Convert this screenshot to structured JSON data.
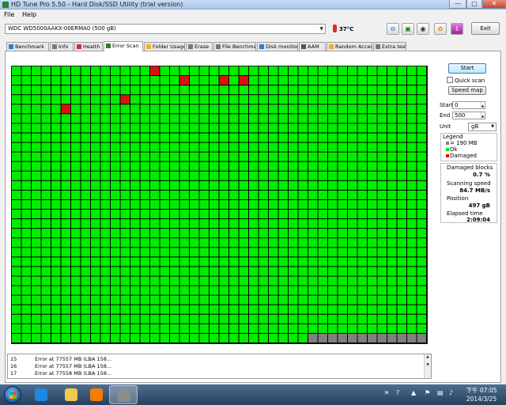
{
  "window": {
    "title": "HD Tune Pro 5.50 - Hard Disk/SSD Utility (trial version)"
  },
  "title_buttons": {
    "minimize": "—",
    "maximize": "□",
    "close": "✕"
  },
  "menu": [
    "File",
    "Help"
  ],
  "toolbar": {
    "drive": "WDC WD5000AAKX-00ERMA0 (500 gB)",
    "temperature": "37°C",
    "exit_label": "Exit",
    "icon_buttons": [
      "copy-icon",
      "save-icon",
      "camera-icon",
      "settings-icon",
      "download-icon"
    ]
  },
  "tabs": [
    {
      "label": "Benchmark",
      "icon": "benchmark-icon",
      "color": "#2b7bd6"
    },
    {
      "label": "Info",
      "icon": "info-icon",
      "color": "#777777"
    },
    {
      "label": "Health",
      "icon": "health-icon",
      "color": "#d32f2f"
    },
    {
      "label": "Error Scan",
      "icon": "magnifier-icon",
      "color": "#2e7d32",
      "active": true
    },
    {
      "label": "Folder Usage",
      "icon": "folder-icon",
      "color": "#f2b320"
    },
    {
      "label": "Erase",
      "icon": "erase-icon",
      "color": "#777777"
    },
    {
      "label": "File Benchmark",
      "icon": "file-icon",
      "color": "#777777"
    },
    {
      "label": "Disk monitor",
      "icon": "monitor-icon",
      "color": "#2b7bd6"
    },
    {
      "label": "AAM",
      "icon": "speaker-icon",
      "color": "#555555"
    },
    {
      "label": "Random Access",
      "icon": "random-icon",
      "color": "#f2b320"
    },
    {
      "label": "Extra tests",
      "icon": "tests-icon",
      "color": "#777777"
    }
  ],
  "scan_map": {
    "cols": 42,
    "rows": 29,
    "colors": {
      "ok": "#00ee00",
      "damaged": "#dd1111",
      "unscanned": "#808080",
      "border": "#000000"
    },
    "damaged_blocks": [
      [
        0,
        14
      ],
      [
        1,
        17
      ],
      [
        1,
        21
      ],
      [
        1,
        23
      ],
      [
        3,
        11
      ],
      [
        4,
        5
      ]
    ],
    "unscanned_start_in_last_row": 30
  },
  "controls": {
    "start_button": "Start",
    "quick_scan_label": "Quick scan",
    "quick_scan_checked": false,
    "speed_map_button": "Speed map",
    "start_label": "Start",
    "start_value": "0",
    "end_label": "End",
    "end_value": "500",
    "unit_label": "Unit",
    "unit_value": "gB"
  },
  "legend": {
    "title": "Legend",
    "items": [
      {
        "swatch": "#808080",
        "label": "= 190 MB"
      },
      {
        "swatch": "#00ee00",
        "label": "Ok"
      },
      {
        "swatch": "#dd1111",
        "label": "Damaged"
      }
    ]
  },
  "stats": {
    "damaged_blocks_label": "Damaged blocks",
    "damaged_blocks_value": "0.7 %",
    "scanning_speed_label": "Scanning speed",
    "scanning_speed_value": "84.7 MB/s",
    "position_label": "Position",
    "position_value": "497 gB",
    "elapsed_time_label": "Elapsed time",
    "elapsed_time_value": "2:09:04"
  },
  "log": [
    {
      "num": "15",
      "message": "Error at 77557 MB (LBA 158..."
    },
    {
      "num": "16",
      "message": "Error at 77557 MB (LBA 158..."
    },
    {
      "num": "17",
      "message": "Error at 77558 MB (LBA 158..."
    }
  ],
  "taskbar": {
    "items": [
      {
        "name": "internet-explorer-icon",
        "color": "#1e88e5"
      },
      {
        "name": "folder-icon",
        "color": "#f2c94c"
      },
      {
        "name": "media-player-icon",
        "color": "#f57c00"
      },
      {
        "name": "hdtune-icon",
        "color": "#8d8d8d"
      }
    ],
    "active_item": 3,
    "tray_ime": "»",
    "time": "下午 07:05",
    "date": "2014/3/25"
  }
}
